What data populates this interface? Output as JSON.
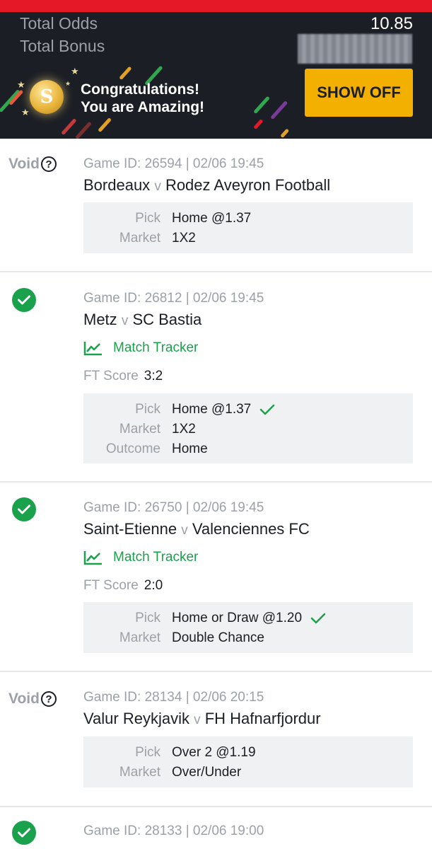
{
  "banner": {
    "total_odds_label": "Total Odds",
    "total_odds_value": "10.85",
    "total_bonus_label": "Total Bonus",
    "congrats_line1": "Congratulations!",
    "congrats_line2": "You are Amazing!",
    "show_off_label": "SHOW OFF"
  },
  "labels": {
    "void": "Void",
    "vs": "v",
    "match_tracker": "Match Tracker",
    "ft_score": "FT Score",
    "pick": "Pick",
    "market": "Market",
    "outcome": "Outcome"
  },
  "bets": [
    {
      "status": "void",
      "game": "Game ID: 26594 | 02/06 19:45",
      "home": "Bordeaux",
      "away": "Rodez Aveyron Football",
      "pick": "Home @1.37",
      "market": "1X2"
    },
    {
      "status": "won",
      "game": "Game ID: 26812 | 02/06 19:45",
      "home": "Metz",
      "away": "SC Bastia",
      "score": "3:2",
      "pick": "Home @1.37",
      "market": "1X2",
      "outcome": "Home"
    },
    {
      "status": "won",
      "game": "Game ID: 26750 | 02/06 19:45",
      "home": "Saint-Etienne",
      "away": "Valenciennes FC",
      "score": "2:0",
      "pick": "Home or Draw @1.20",
      "market": "Double Chance"
    },
    {
      "status": "void",
      "game": "Game ID: 28134 | 02/06 20:15",
      "home": "Valur Reykjavik",
      "away": "FH Hafnarfjordur",
      "pick": "Over 2 @1.19",
      "market": "Over/Under"
    },
    {
      "status": "won",
      "game": "Game ID: 28133 | 02/06 19:00"
    }
  ],
  "colors": {
    "brand_red": "#e41827",
    "banner_bg": "#1b1e25",
    "accent_yellow": "#f4b000",
    "success_green": "#1aa14b",
    "muted_text": "#9ca0a8"
  }
}
